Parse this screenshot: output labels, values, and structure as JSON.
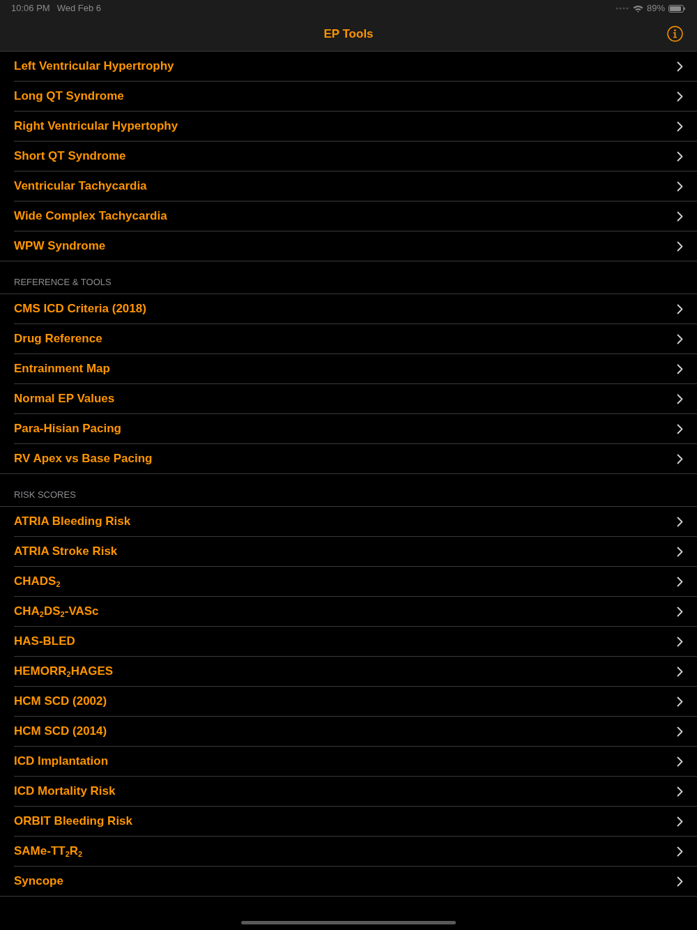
{
  "status_bar": {
    "time": "10:06 PM",
    "date": "Wed Feb 6",
    "battery": "89%"
  },
  "nav_bar": {
    "title": "EP Tools"
  },
  "sections": [
    {
      "items": [
        "Left Ventricular Hypertrophy",
        "Long QT Syndrome",
        "Right Ventricular Hypertophy",
        "Short QT Syndrome",
        "Ventricular Tachycardia",
        "Wide Complex Tachycardia",
        "WPW Syndrome"
      ]
    },
    {
      "header": "REFERENCE & TOOLS",
      "items": [
        "CMS ICD Criteria (2018)",
        "Drug Reference",
        "Entrainment Map",
        "Normal EP Values",
        "Para-Hisian Pacing",
        "RV Apex vs Base Pacing"
      ]
    },
    {
      "header": "RISK SCORES",
      "items": [
        "ATRIA Bleeding Risk",
        "ATRIA Stroke Risk",
        "CHADS$_{2}$",
        "CHA$_{2}$DS$_{2}$-VASc",
        "HAS-BLED",
        "HEMORR$_{2}$HAGES",
        "HCM SCD (2002)",
        "HCM SCD (2014)",
        "ICD Implantation",
        "ICD Mortality Risk",
        "ORBIT Bleeding Risk",
        "SAMe-TT$_{2}$R$_{2}$",
        "Syncope"
      ]
    }
  ]
}
